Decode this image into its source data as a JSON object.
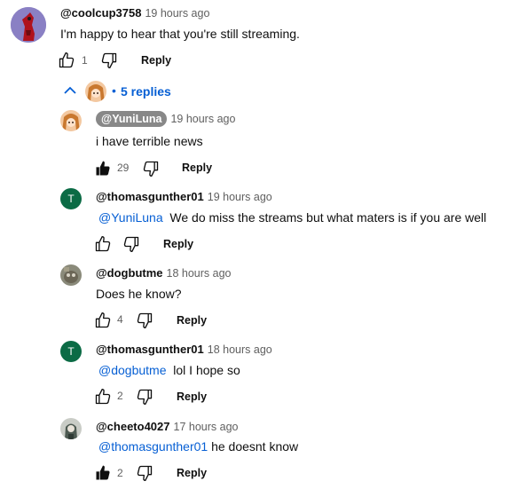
{
  "top_comment": {
    "handle": "@coolcup3758",
    "time": "19 hours ago",
    "text": "I'm happy to hear that you're still streaming.",
    "likes": "1",
    "reply_label": "Reply"
  },
  "replies_toggle": {
    "icon": "chevron-up-icon",
    "label": "5 replies"
  },
  "replies": [
    {
      "handle": "@YuniLuna",
      "time": "19 hours ago",
      "mention": "",
      "text": "i have terrible news",
      "likes": "29",
      "reply_label": "Reply",
      "avatar_letter": "",
      "liked": true
    },
    {
      "handle": "@thomasgunther01",
      "time": "19 hours ago",
      "mention": "@YuniLuna",
      "text": "We do miss the streams but what maters is if you are well",
      "likes": "",
      "reply_label": "Reply",
      "avatar_letter": "T",
      "liked": false
    },
    {
      "handle": "@dogbutme",
      "time": "18 hours ago",
      "mention": "",
      "text": "Does he know?",
      "likes": "4",
      "reply_label": "Reply",
      "avatar_letter": "",
      "liked": false
    },
    {
      "handle": "@thomasgunther01",
      "time": "18 hours ago",
      "mention": "@dogbutme",
      "text": "lol I hope so",
      "likes": "2",
      "reply_label": "Reply",
      "avatar_letter": "T",
      "liked": false
    },
    {
      "handle": "@cheeto4027",
      "time": "17 hours ago",
      "mention": "@thomasgunther01",
      "text": "he doesnt know",
      "likes": "2",
      "reply_label": "Reply",
      "avatar_letter": "",
      "liked": true
    }
  ],
  "colors": {
    "link": "#065fd4",
    "avatar_green": "#0b6b45",
    "muted": "#606060"
  }
}
